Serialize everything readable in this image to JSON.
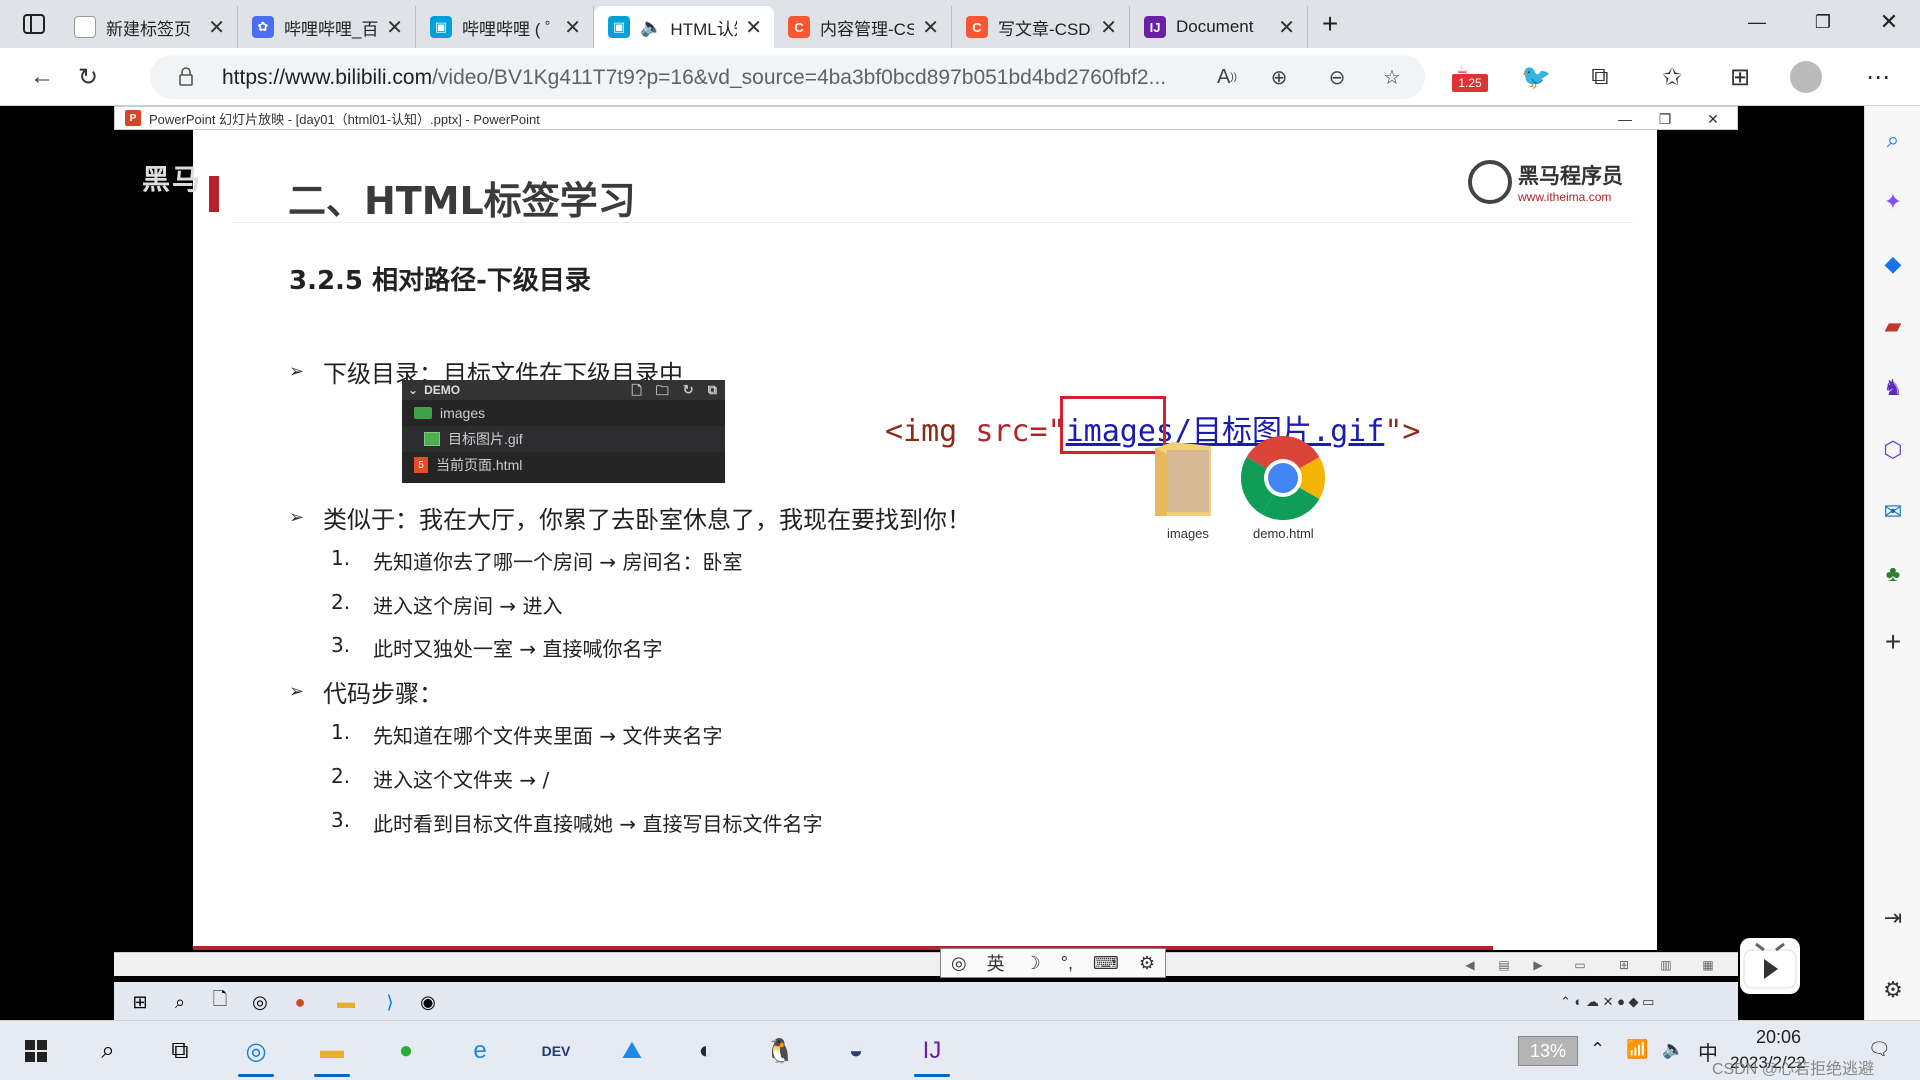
{
  "browser": {
    "tabs": [
      {
        "label": "新建标签页",
        "favicon_color": "#6b6b6b"
      },
      {
        "label": "哔哩哔哩_百度",
        "favicon_color": "#4e6ef2"
      },
      {
        "label": "哔哩哔哩 ( ゜- ゜",
        "favicon_color": "#00a1d6"
      },
      {
        "label": "HTML认知",
        "favicon_color": "#00a1d6"
      },
      {
        "label": "内容管理-CSDN",
        "favicon_color": "#fc5531"
      },
      {
        "label": "写文章-CSDN博",
        "favicon_color": "#fc5531"
      },
      {
        "label": "Document",
        "favicon_color": "#6a1fa5"
      }
    ],
    "url_host": "https://www.bilibili.com",
    "url_path": "/video/BV1Kg411T7t9?p=16&vd_source=4ba3bf0bcd897b051bd4bd2760fbf2...",
    "playback_badge": "1.25",
    "colors": {
      "accent": "#0067c0",
      "active_tab": "#ffffff",
      "tabstrip": "#dfe3e8"
    }
  },
  "ppt": {
    "window_title": "PowerPoint 幻灯片放映 - [day01（html01-认知）.pptx] - PowerPoint",
    "overlay_logo": "黑马",
    "slide": {
      "title": "二、HTML标签学习",
      "brand_name": "黑马程序员",
      "brand_url": "www.itheima.com",
      "subtitle": "3.2.5 相对路径-下级目录",
      "bullet1": "下级目录：目标文件在下级目录中",
      "tree": {
        "header": "DEMO",
        "folder": "images",
        "image_file": "目标图片.gif",
        "html_file": "当前页面.html"
      },
      "code": {
        "open": "<img ",
        "attr": "src",
        "eq": "=\"",
        "highlight": "images",
        "rest": "/目标图片.gif",
        "close": "\">"
      },
      "bullet2": "类似于：我在大厅，你累了去卧室休息了，我现在要找到你！",
      "bullet2_steps": [
        {
          "n": "1.",
          "text": "先知道你去了哪一个房间 → 房间名：卧室"
        },
        {
          "n": "2.",
          "text": "进入这个房间 → 进入"
        },
        {
          "n": "3.",
          "text": "此时又独处一室 → 直接喊你名字"
        }
      ],
      "bullet3": "代码步骤：",
      "bullet3_steps": [
        {
          "n": "1.",
          "text": "先知道在哪个文件夹里面 → 文件夹名字"
        },
        {
          "n": "2.",
          "text": "进入这个文件夹 → /"
        },
        {
          "n": "3.",
          "text": "此时看到目标文件直接喊她 → 直接写目标文件名字"
        }
      ],
      "icon_folder_label": "images",
      "icon_chrome_label": "demo.html"
    },
    "ime_lang": "英"
  },
  "taskbar": {
    "battery_text": "13%",
    "ime": "中",
    "time": "20:06",
    "date": "2023/2/22",
    "watermark": "CSDN @心若拒绝逃避"
  }
}
